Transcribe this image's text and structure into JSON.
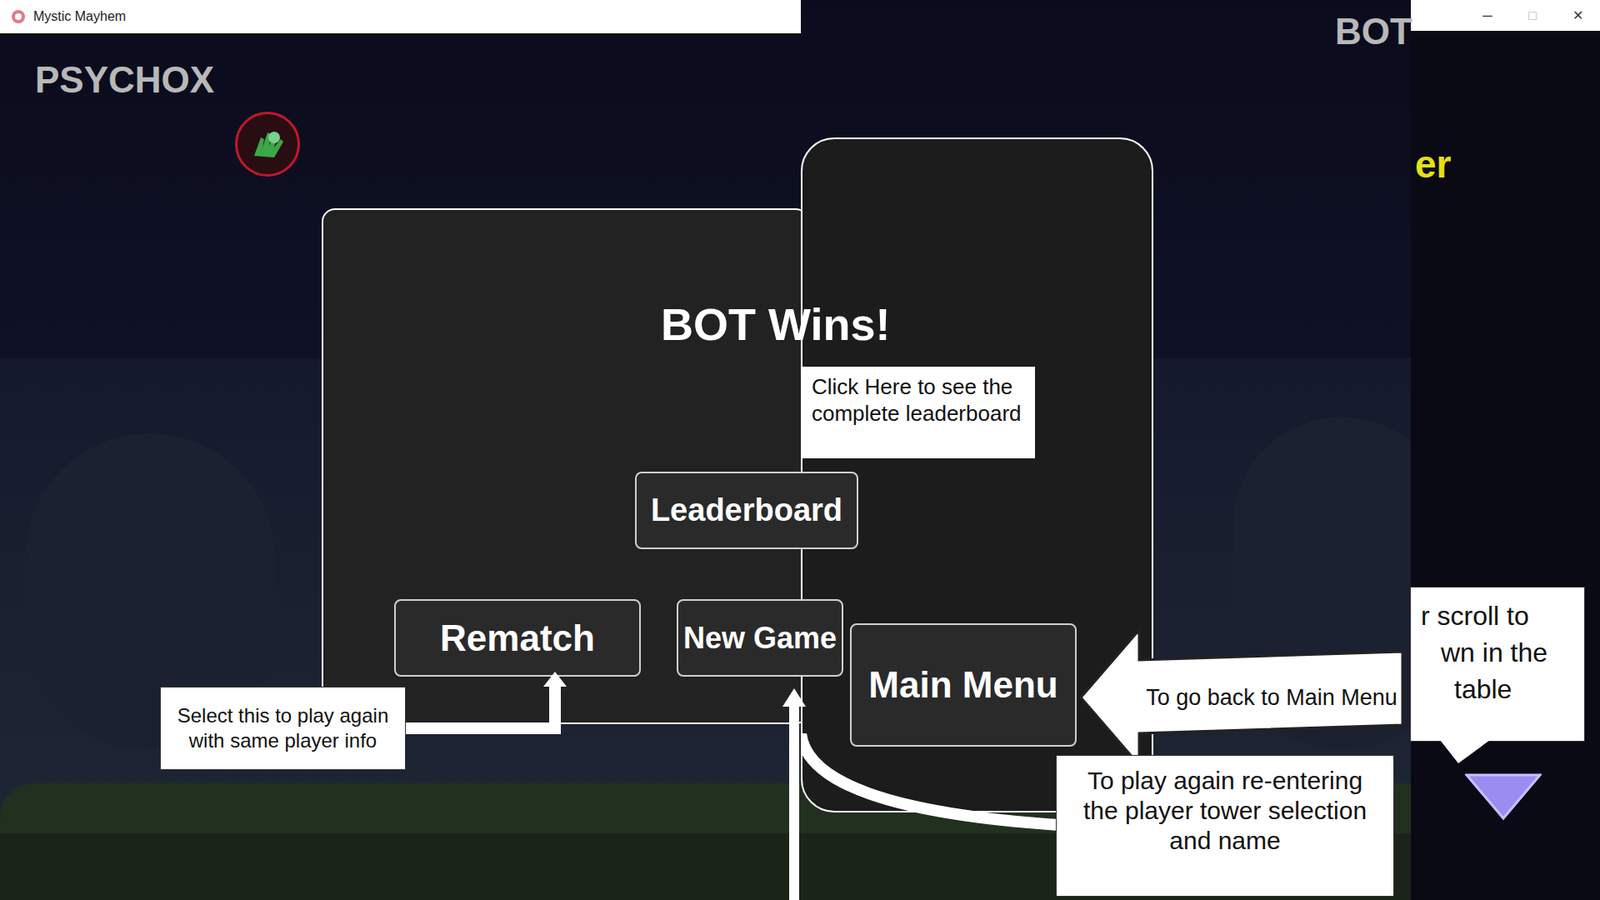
{
  "window": {
    "title": "Mystic Mayhem",
    "controls": [
      "─",
      "□",
      "✕"
    ]
  },
  "players": {
    "left": "PSYCHOX",
    "right": "BOT"
  },
  "dialog": {
    "title": "BOT Wins!",
    "buttons": [
      {
        "label": "Leaderboard"
      },
      {
        "label": "Rematch"
      },
      {
        "label": "New Game"
      },
      {
        "label": "Main Menu"
      }
    ]
  },
  "callouts": {
    "leaderboard": "Click Here to see the complete leaderboard",
    "rematch": "Select this to play again with same player info",
    "main_menu": "To go back to Main Menu",
    "new_game": "To play again re-entering the player tower selection and name"
  },
  "side_panel": {
    "heading": "er",
    "hint_lines": [
      "r scroll to",
      "wn in the",
      "table"
    ]
  }
}
